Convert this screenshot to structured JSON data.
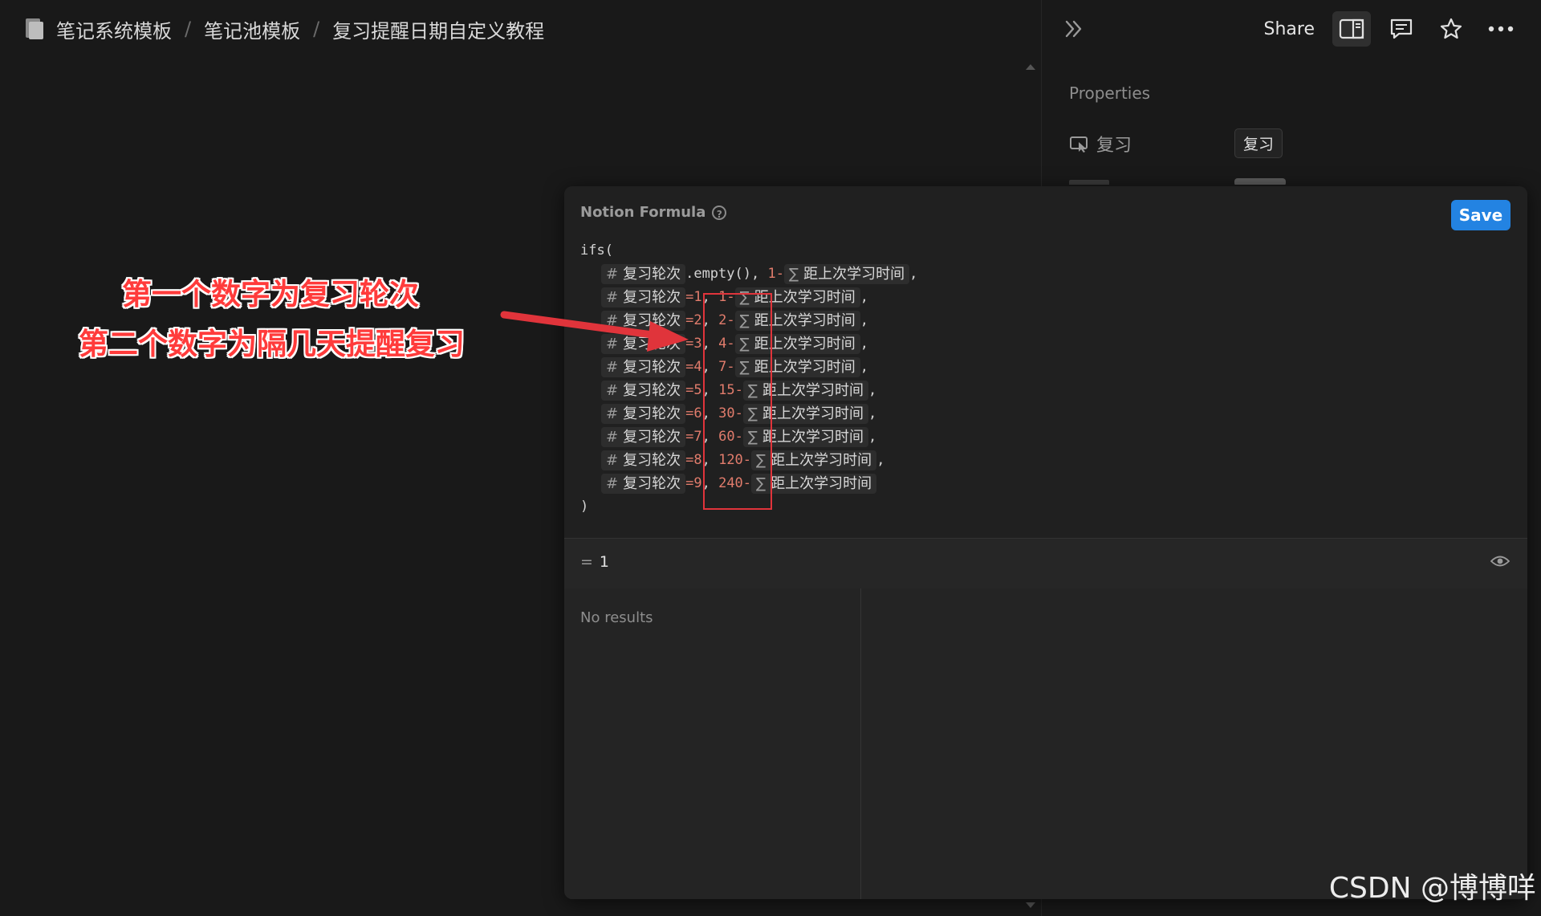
{
  "breadcrumb": {
    "items": [
      "笔记系统模板",
      "笔记池模板",
      "复习提醒日期自定义教程"
    ],
    "separator": "/"
  },
  "header": {
    "share_label": "Share",
    "icons": [
      "collapse-panel-icon",
      "side-peek-icon",
      "comment-icon",
      "star-icon",
      "more-icon"
    ]
  },
  "properties": {
    "title": "Properties",
    "row": {
      "name": "复习",
      "value": "复习"
    }
  },
  "formula": {
    "title": "Notion Formula",
    "save_label": "Save",
    "open": "ifs(",
    "close": ")",
    "prop_round": "复习轮次",
    "prop_distance": "距上次学习时间",
    "hash": "#",
    "sigma": "∑",
    "first_line": {
      "method": ".empty()",
      "sep": ",",
      "num": "1",
      "minus": "-"
    },
    "cases": [
      {
        "round": "1",
        "days": "1"
      },
      {
        "round": "2",
        "days": "2"
      },
      {
        "round": "3",
        "days": "4"
      },
      {
        "round": "4",
        "days": "7"
      },
      {
        "round": "5",
        "days": "15"
      },
      {
        "round": "6",
        "days": "30"
      },
      {
        "round": "7",
        "days": "60"
      },
      {
        "round": "8",
        "days": "120"
      },
      {
        "round": "9",
        "days": "240"
      }
    ],
    "result_prefix": "=",
    "result_value": "1",
    "no_results": "No results"
  },
  "annotation": {
    "line1": "第一个数字为复习轮次",
    "line2": "第二个数字为隔几天提醒复习",
    "color": "#ff3b3b"
  },
  "watermark": "CSDN @博博咩",
  "colors": {
    "accent": "#2383e2",
    "number": "#e17c6c",
    "annotation": "#e0343b"
  }
}
